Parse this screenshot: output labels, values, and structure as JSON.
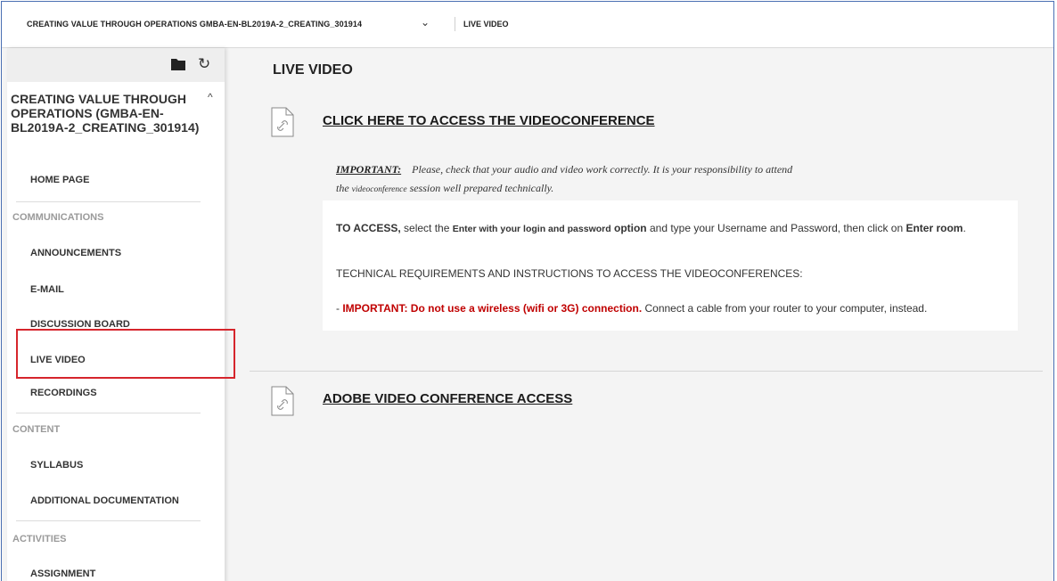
{
  "topbar": {
    "course": "CREATING VALUE THROUGH OPERATIONS GMBA-EN-BL2019A-2_CREATING_301914",
    "chevron": "⌄",
    "page": "LIVE VIDEO"
  },
  "sidebar": {
    "course_title": "CREATING VALUE THROUGH OPERATIONS (GMBA-EN-BL2019A-2_CREATING_301914)",
    "toggle": "^",
    "items": [
      {
        "label": "HOME PAGE"
      },
      {
        "label": "COMMUNICATIONS",
        "section": true
      },
      {
        "label": "ANNOUNCEMENTS"
      },
      {
        "label": "E-MAIL"
      },
      {
        "label": "DISCUSSION BOARD"
      },
      {
        "label": "LIVE VIDEO",
        "active": true
      },
      {
        "label": "RECORDINGS"
      },
      {
        "label": "CONTENT",
        "section": true
      },
      {
        "label": "SYLLABUS"
      },
      {
        "label": "ADDITIONAL DOCUMENTATION"
      },
      {
        "label": "ACTIVITIES",
        "section": true
      },
      {
        "label": "ASSIGNMENT"
      }
    ],
    "highlight_color": "#d6252c"
  },
  "main": {
    "title": "LIVE VIDEO",
    "items": [
      {
        "link": "CLICK HERE TO ACCESS THE VIDEOCONFERENCE",
        "important_label": "IMPORTANT:",
        "important_text": "Please, check that your audio and video work correctly. It is your responsibility to attend",
        "important_line2_pre": "the",
        "important_line2_small": "videoconference",
        "important_line2_post": "session well prepared technically.",
        "access_lead": "TO ACCESS,",
        "access_mid1": " select the ",
        "access_option": "Enter with your login and password",
        "access_option_word": " option",
        "access_mid2": " and type your Username and Password, then click on ",
        "access_room": "Enter room",
        "access_end": ".",
        "requirements": "TECHNICAL REQUIREMENTS AND INSTRUCTIONS TO ACCESS THE VIDEOCONFERENCES:",
        "warning_dash": "- ",
        "warning_red": "IMPORTANT: Do not use a wireless (wifi or 3G) connection.",
        "warning_rest": " Connect a cable from your router to your computer, instead."
      },
      {
        "link": "ADOBE VIDEO CONFERENCE ACCESS"
      }
    ],
    "warning_color": "#c00000"
  }
}
